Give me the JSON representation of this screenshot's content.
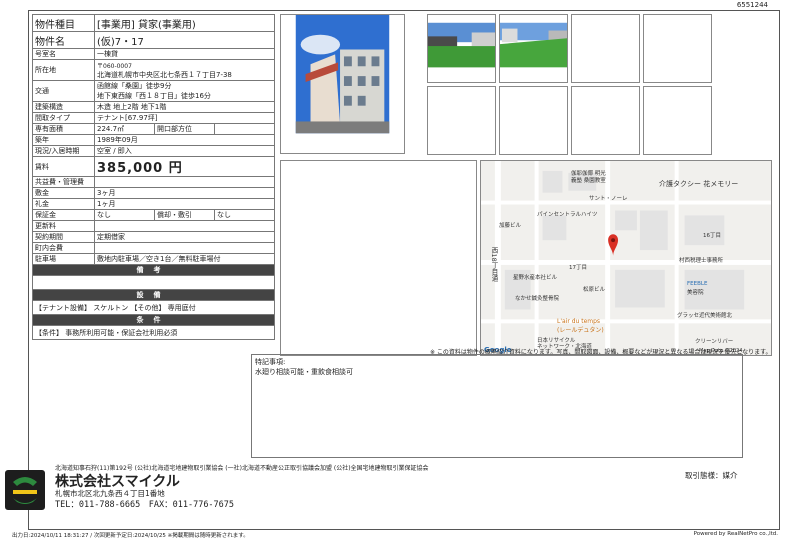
{
  "ref_id": "6551244",
  "spec": {
    "type_label": "物件種目",
    "type_value": "[事業用] 貸家(事業用)",
    "name_label": "物件名",
    "name_value": "(仮)7・17",
    "room_label": "号室名",
    "room_value": "一棟貸",
    "addr_label": "所在地",
    "addr_zip": "〒060-0007",
    "addr_value": "北海道札幌市中央区北七条西１７丁目7-38",
    "transit_label": "交通",
    "transit_line1": "函館線「桑園」徒歩9分",
    "transit_line2": "地下東西線「西１８丁目」徒歩16分",
    "structure_label": "建築構造",
    "structure_value": "木造 地上2階 地下1階",
    "layout_label": "間取タイプ",
    "layout_value": "テナント[67.97坪]",
    "area_label": "専有面積",
    "area_value": "224.7㎡",
    "direction_label": "開口部方位",
    "direction_value": "",
    "built_label": "築年",
    "built_value": "1989年09月",
    "status_label": "現況/入居時期",
    "status_value": "空室 / 即入",
    "rent_label": "賃料",
    "rent_value": "385,000 円",
    "fee_label": "共益費・管理費",
    "fee_value": "",
    "deposit_label": "敷金",
    "deposit_value": "3ヶ月",
    "keymoney_label": "礼金",
    "keymoney_value": "1ヶ月",
    "guarantee_label": "保証金",
    "guarantee_value": "なし",
    "amortize_label": "償却・敷引",
    "amortize_value": "なし",
    "renew_label": "更新料",
    "renew_value": "",
    "contract_label": "契約期間",
    "contract_value": "定期借家",
    "town_fee_label": "町内会費",
    "town_fee_value": "",
    "parking_label": "駐車場",
    "parking_value": "敷地内駐車場／空き1台／無料駐車場付",
    "remarks_header": "備考",
    "facility_header": "設備",
    "facility_value": "【テナント設備】 スケルトン 【その他】 専用庭付",
    "condition_header": "条件",
    "condition_value": "【条件】 事務所利用可能・保証会社利用必須"
  },
  "map": {
    "labels": [
      "伽耶伽倻 明光",
      "義塾 桑園教室",
      "サント・ノーレ",
      "パインセントラルハイツ",
      "介護タクシー 花メモリー",
      "加藤ビル",
      "西18丁目通",
      "16丁目",
      "17丁目",
      "星野水産本社ビル",
      "村西税理士事務所",
      "FEEBLE",
      "美容院",
      "なかせ鍼灸整骨院",
      "松原ビル",
      "L'air du temps",
      "(レールデュタン)",
      "グラッセ近代美術館北",
      "日本リサイクル",
      "ネットワーク・北海道",
      "クリーンリバー",
      "Google",
      "Map Data ©2024"
    ]
  },
  "disclaimer": "※ この資料は物件の概略紹介資料になります。写真、間取図面、設備、概要などが現況と異なる場合は現況を優先となります。",
  "remarks": {
    "title": "特記事項:",
    "body": "水廻り相談可能・重飲食相談可"
  },
  "footer": {
    "association": "北海道知事石狩(11)第192号 (公社)北海道宅地建物取引業協会 (一社)北海道不動産公正取引協議会加盟 (公社)全国宅地建物取引業保証協会",
    "company": "株式会社スマイクル",
    "address": "札幌市北区北九条西４丁目1番地",
    "tel": "TEL：011-788-6665　FAX：011-776-7675",
    "broker": "取引態様：媒介",
    "output_info": "出力日:2024/10/11 18:31:27 / 次回更新予定日:2024/10/25 ※掲載期間は随時更新されます。",
    "powered_by": "Powered by RealNetPro co.,ltd."
  },
  "colors": {
    "header_bg": "#444444",
    "logo_green": "#2d8a3e",
    "logo_yellow": "#f0c419",
    "pin_red": "#d93025"
  }
}
